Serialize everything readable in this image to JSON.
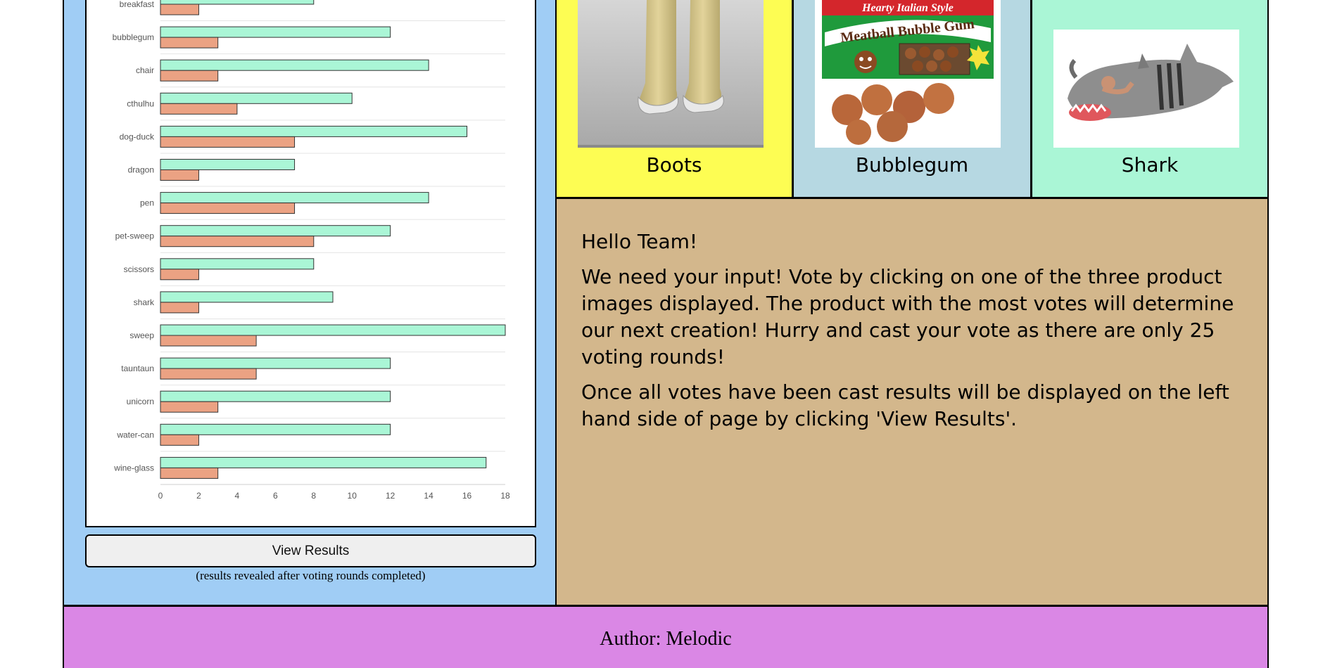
{
  "results_panel": {
    "view_results_label": "View Results",
    "note": "(results revealed after voting rounds completed)"
  },
  "products": [
    {
      "label": "Boots",
      "image": "yellow rain boots"
    },
    {
      "label": "Bubblegum",
      "image": "meatball bubble gum package"
    },
    {
      "label": "Shark",
      "image": "shark sleeping bag"
    }
  ],
  "bubblegum_package": {
    "top_line": "Hearty Italian Style",
    "title": "Meatball Bubble Gum"
  },
  "message": {
    "greeting": "Hello Team!",
    "paragraph1": "We need your input! Vote by clicking on one of the three product images displayed. The product with the most votes will determine our next creation! Hurry and cast your vote as there are only 25 voting rounds!",
    "paragraph2": "Once all votes have been cast results will be displayed on the left hand side of page by clicking 'View Results'."
  },
  "footer": {
    "author": "Author: Melodic"
  },
  "colors": {
    "left_panel": "#a0cdf5",
    "boots_bg": "#fdfd53",
    "bubblegum_bg": "#b6d8e2",
    "shark_bg": "#aaf6d6",
    "message_bg": "#d3b78c",
    "footer_bg": "#da87e5",
    "series_views": "#aaf6d6",
    "series_votes": "#eba283"
  },
  "chart_data": {
    "type": "bar",
    "orientation": "horizontal",
    "categories": [
      "breakfast",
      "bubblegum",
      "chair",
      "cthulhu",
      "dog-duck",
      "dragon",
      "pen",
      "pet-sweep",
      "scissors",
      "shark",
      "sweep",
      "tauntaun",
      "unicorn",
      "water-can",
      "wine-glass"
    ],
    "series": [
      {
        "values": [
          8,
          12,
          14,
          10,
          16,
          7,
          14,
          12,
          8,
          9,
          18,
          12,
          12,
          12,
          17
        ]
      },
      {
        "values": [
          2,
          3,
          3,
          4,
          7,
          2,
          7,
          8,
          2,
          2,
          5,
          5,
          3,
          2,
          3
        ]
      }
    ],
    "xlim": [
      0,
      18
    ],
    "xticks": [
      "0",
      "2",
      "4",
      "6",
      "8",
      "10",
      "12",
      "14",
      "16",
      "18"
    ],
    "grid": true
  }
}
